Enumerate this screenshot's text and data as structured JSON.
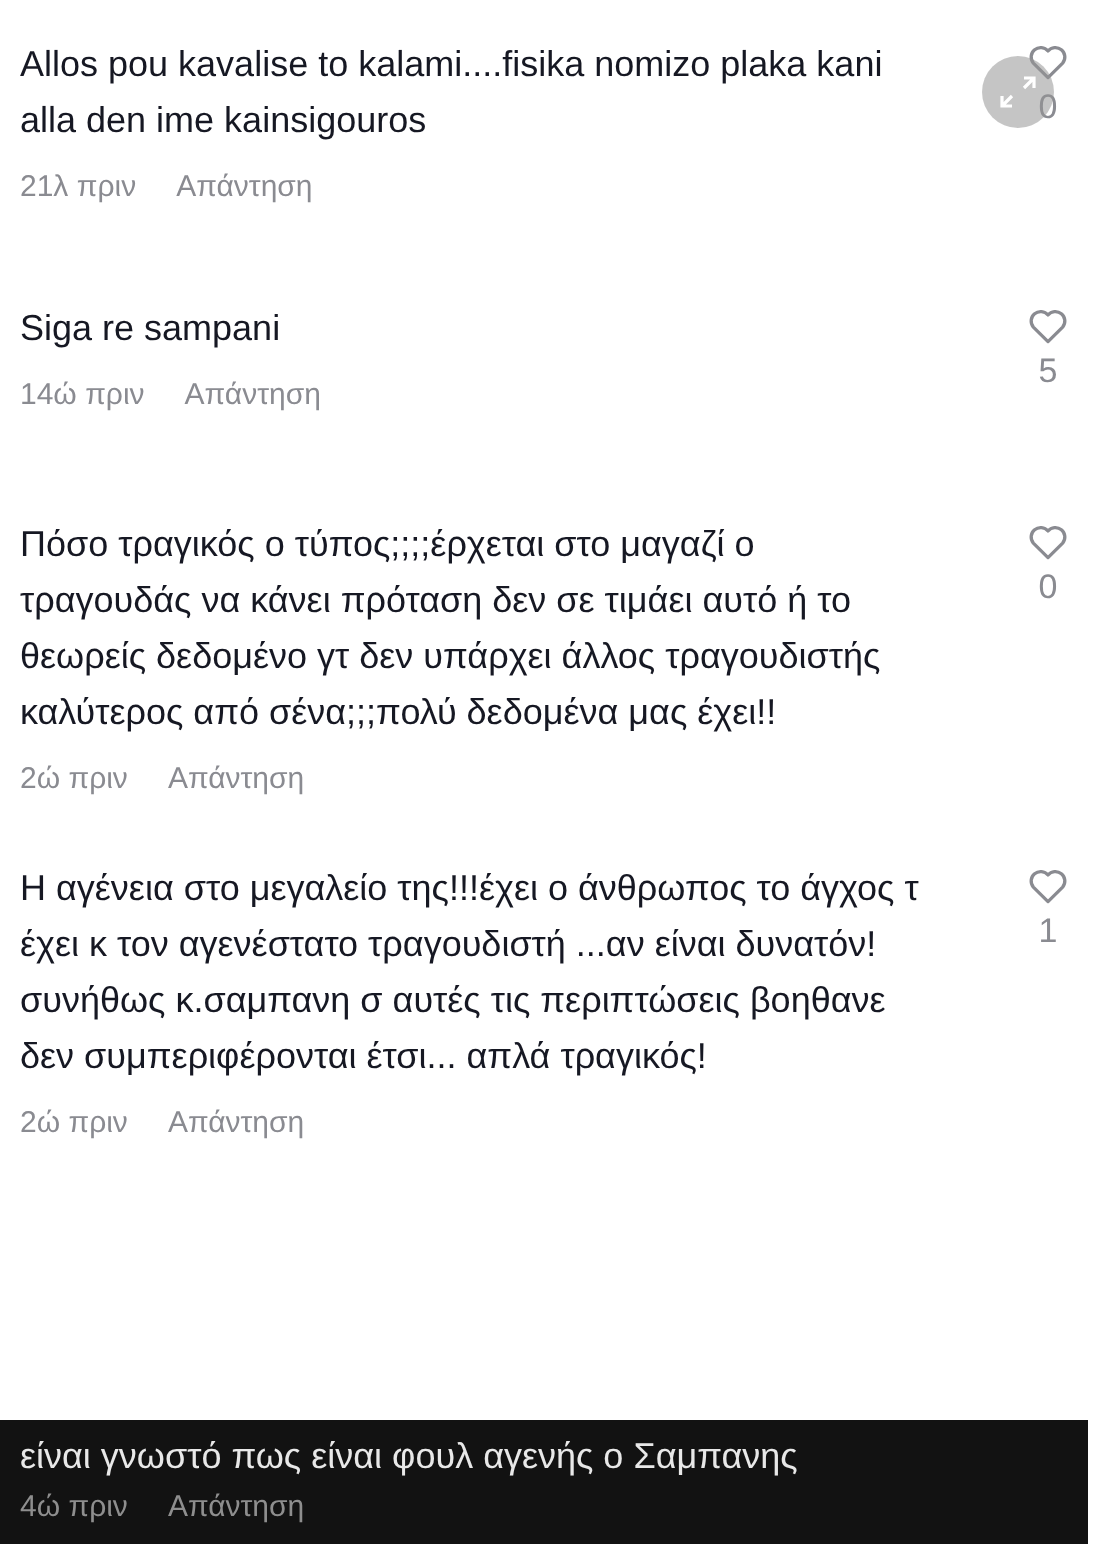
{
  "comments": [
    {
      "kind": "light",
      "text": "Allos pou kavalise to kalami....fisika nomizo plaka kani alla den ime kainsigouros",
      "time": "21λ πριν",
      "reply": "Απάντηση",
      "likes": "0"
    },
    {
      "kind": "light",
      "text": "Siga re sampani",
      "time": "14ώ πριν",
      "reply": "Απάντηση",
      "likes": "5"
    },
    {
      "kind": "light",
      "text": "Πόσο τραγικός ο τύπος;;;;έρχεται στο μαγαζί ο τραγουδάς να κάνει πρόταση δεν σε τιμάει αυτό ή το θεωρείς δεδομένο γτ δεν υπάρχει άλλος τραγουδιστής καλύτερος από σένα;;;πολύ δεδομένα μας έχει!!",
      "time": "2ώ πριν",
      "reply": "Απάντηση",
      "likes": "0"
    },
    {
      "kind": "light",
      "text": "Η αγένεια στο μεγαλείο της!!!έχει ο άνθρωπος το άγχος τ έχει κ τον αγενέστατο τραγουδιστή ...αν είναι δυνατόν!συνήθως κ.σαμπανη σ αυτές τις περιπτώσεις βοηθανε δεν συμπεριφέρονται έτσι... απλά τραγικός!",
      "time": "2ώ πριν",
      "reply": "Απάντηση",
      "likes": "1"
    },
    {
      "kind": "dark",
      "text": "είναι γνωστό πως είναι φουλ αγενής ο Σαμπανης",
      "time": "4ώ πριν",
      "reply": "Απάντηση"
    }
  ]
}
